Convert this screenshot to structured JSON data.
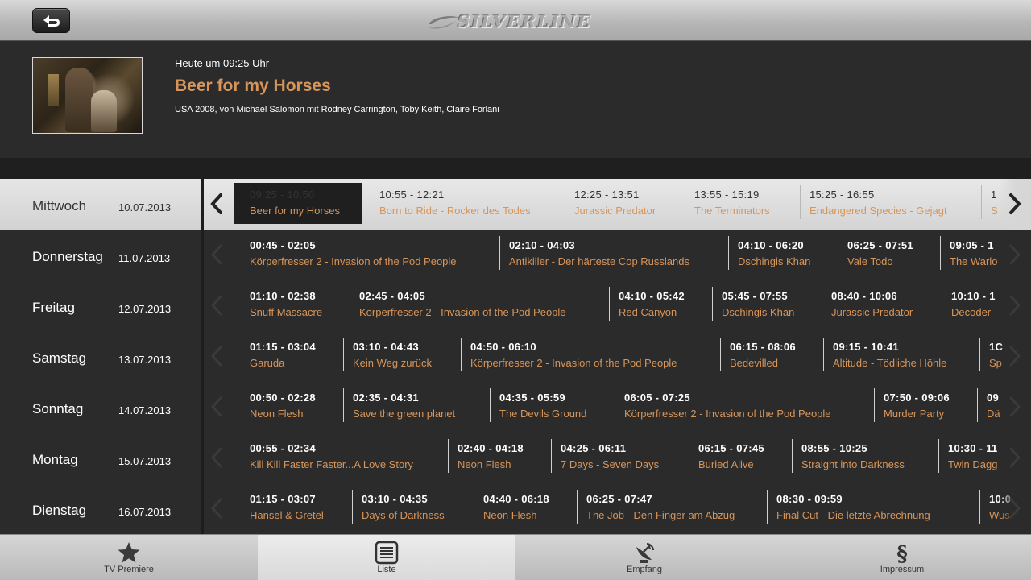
{
  "app": {
    "logo_text": "SILVERLINE"
  },
  "now": {
    "time_label": "Heute um 09:25 Uhr",
    "title": "Beer for my Horses",
    "description": "USA 2008, von Michael Salomon mit Rodney Carrington, Toby Keith, Claire Forlani"
  },
  "days": [
    {
      "name": "Mittwoch",
      "date": "10.07.2013",
      "active": true
    },
    {
      "name": "Donnerstag",
      "date": "11.07.2013"
    },
    {
      "name": "Freitag",
      "date": "12.07.2013"
    },
    {
      "name": "Samstag",
      "date": "13.07.2013"
    },
    {
      "name": "Sonntag",
      "date": "14.07.2013"
    },
    {
      "name": "Montag",
      "date": "15.07.2013"
    },
    {
      "name": "Dienstag",
      "date": "16.07.2013"
    }
  ],
  "schedule": [
    [
      {
        "time": "09:25 - 10:50",
        "title": "Beer for my Horses",
        "selected": true
      },
      {
        "time": "10:55 - 12:21",
        "title": "Born to Ride - Rocker des Todes"
      },
      {
        "time": "12:25 - 13:51",
        "title": "Jurassic Predator"
      },
      {
        "time": "13:55 - 15:19",
        "title": "The Terminators"
      },
      {
        "time": "15:25 - 16:55",
        "title": "Endangered Species - Gejagt"
      },
      {
        "time": "1",
        "title": "S"
      }
    ],
    [
      {
        "time": "00:45 - 02:05",
        "title": "Körperfresser 2 - Invasion of the Pod People"
      },
      {
        "time": "02:10 - 04:03",
        "title": "Antikiller - Der härteste Cop Russlands"
      },
      {
        "time": "04:10 - 06:20",
        "title": "Dschingis Khan"
      },
      {
        "time": "06:25 - 07:51",
        "title": "Vale Todo"
      },
      {
        "time": "09:05 - 1",
        "title": "The Warlo"
      }
    ],
    [
      {
        "time": "01:10 - 02:38",
        "title": "Snuff Massacre"
      },
      {
        "time": "02:45 - 04:05",
        "title": "Körperfresser 2 - Invasion of the Pod People"
      },
      {
        "time": "04:10 - 05:42",
        "title": "Red Canyon"
      },
      {
        "time": "05:45 - 07:55",
        "title": "Dschingis Khan"
      },
      {
        "time": "08:40 - 10:06",
        "title": "Jurassic Predator"
      },
      {
        "time": "10:10 - 1",
        "title": "Decoder -"
      }
    ],
    [
      {
        "time": "01:15 - 03:04",
        "title": "Garuda"
      },
      {
        "time": "03:10 - 04:43",
        "title": "Kein Weg zurück"
      },
      {
        "time": "04:50 - 06:10",
        "title": "Körperfresser 2 - Invasion of the Pod People"
      },
      {
        "time": "06:15 - 08:06",
        "title": "Bedevilled"
      },
      {
        "time": "09:15 - 10:41",
        "title": "Altitude - Tödliche Höhle"
      },
      {
        "time": "1C",
        "title": "Sp"
      }
    ],
    [
      {
        "time": "00:50 - 02:28",
        "title": "Neon Flesh"
      },
      {
        "time": "02:35 - 04:31",
        "title": "Save the green planet"
      },
      {
        "time": "04:35 - 05:59",
        "title": "The Devils Ground"
      },
      {
        "time": "06:05 - 07:25",
        "title": "Körperfresser 2 - Invasion of the Pod People"
      },
      {
        "time": "07:50 - 09:06",
        "title": "Murder Party"
      },
      {
        "time": "09",
        "title": "Dä"
      }
    ],
    [
      {
        "time": "00:55 - 02:34",
        "title": "Kill Kill Faster Faster...A Love Story"
      },
      {
        "time": "02:40 - 04:18",
        "title": "Neon Flesh"
      },
      {
        "time": "04:25 - 06:11",
        "title": "7 Days - Seven Days"
      },
      {
        "time": "06:15 - 07:45",
        "title": "Buried Alive"
      },
      {
        "time": "08:55 - 10:25",
        "title": "Straight into Darkness"
      },
      {
        "time": "10:30 - 11",
        "title": "Twin Dagg"
      }
    ],
    [
      {
        "time": "01:15 - 03:07",
        "title": "Hansel & Gretel"
      },
      {
        "time": "03:10 - 04:35",
        "title": "Days of Darkness"
      },
      {
        "time": "04:40 - 06:18",
        "title": "Neon Flesh"
      },
      {
        "time": "06:25 - 07:47",
        "title": "The Job - Den Finger am Abzug"
      },
      {
        "time": "08:30 - 09:59",
        "title": "Final Cut - Die letzte Abrechnung"
      },
      {
        "time": "10:0",
        "title": "Wus"
      }
    ]
  ],
  "tabs": [
    {
      "label": "TV Premiere",
      "icon": "star-icon"
    },
    {
      "label": "Liste",
      "icon": "list-icon",
      "active": true
    },
    {
      "label": "Empfang",
      "icon": "satellite-icon"
    },
    {
      "label": "Impressum",
      "icon": "section-icon"
    }
  ],
  "colors": {
    "accent": "#d8955a",
    "background": "#2b2b2b",
    "active_row": "#d8d8d8"
  }
}
